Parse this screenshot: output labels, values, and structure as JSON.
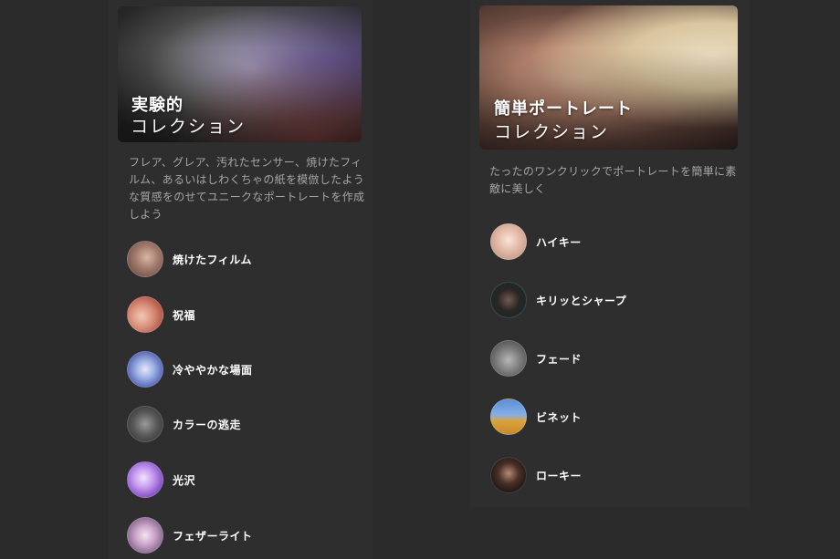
{
  "left": {
    "title": "実験的",
    "subtitle": "コレクション",
    "description": "フレア、グレア、汚れたセンサー、焼けたフィルム、あるいはしわくちゃの紙を模倣したような質感をのせてユニークなポートレートを作成しよう",
    "items": [
      {
        "label": "焼けたフィルム"
      },
      {
        "label": "祝福"
      },
      {
        "label": "冷ややかな場面"
      },
      {
        "label": "カラーの逃走"
      },
      {
        "label": "光沢"
      },
      {
        "label": "フェザーライト"
      }
    ]
  },
  "right": {
    "title": "簡単ポートレート",
    "subtitle": "コレクション",
    "description": "たったのワンクリックでポートレートを簡単に素敵に美しく",
    "items": [
      {
        "label": "ハイキー"
      },
      {
        "label": "キリッとシャープ"
      },
      {
        "label": "フェード"
      },
      {
        "label": "ビネット"
      },
      {
        "label": "ローキー"
      }
    ]
  }
}
